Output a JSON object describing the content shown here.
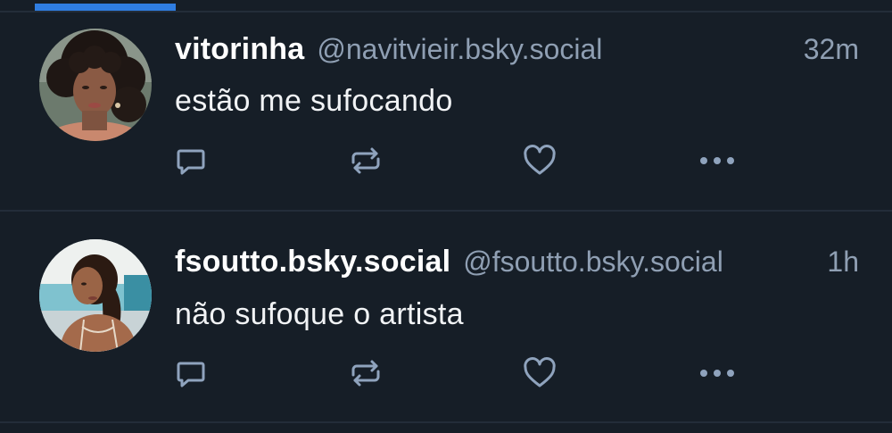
{
  "feed": {
    "posts": [
      {
        "display_name": "vitorinha",
        "handle": "@navitvieir.bsky.social",
        "time": "32m",
        "text": "estão me sufocando",
        "avatar": "avatar-woman-curly-hair"
      },
      {
        "display_name": "fsoutto.bsky.social",
        "handle": "@fsoutto.bsky.social",
        "time": "1h",
        "text": "não sufoque o artista",
        "avatar": "avatar-woman-beach"
      }
    ],
    "actions": {
      "reply_icon": "reply-icon",
      "repost_icon": "repost-icon",
      "like_icon": "heart-icon",
      "more_icon": "more-icon"
    }
  },
  "colors": {
    "background": "#161e27",
    "divider": "#232d39",
    "accent": "#2f7de1",
    "muted_text": "#8f9fb3",
    "icon": "#8fa3bd"
  }
}
